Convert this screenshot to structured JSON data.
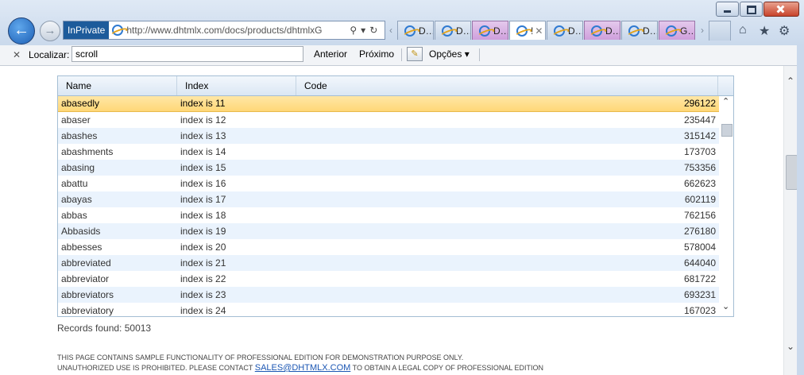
{
  "browser": {
    "inprivate_label": "InPrivate",
    "url": "http://www.dhtmlx.com/docs/products/dhtmlxG",
    "tabs": [
      {
        "label": "D…",
        "style": "normal"
      },
      {
        "label": "D…",
        "style": "normal"
      },
      {
        "label": "D…",
        "style": "purple"
      },
      {
        "label": "!",
        "style": "active"
      },
      {
        "label": "D…",
        "style": "normal"
      },
      {
        "label": "D…",
        "style": "purple"
      },
      {
        "label": "D…",
        "style": "normal"
      },
      {
        "label": "G…",
        "style": "purple"
      }
    ],
    "tab_close_glyph": "✕"
  },
  "findbar": {
    "label": "Localizar:",
    "query": "scroll",
    "prev_label": "Anterior",
    "next_label": "Próximo",
    "options_label": "Opções"
  },
  "grid": {
    "columns": [
      "Name",
      "Index",
      "Code"
    ],
    "rows": [
      {
        "name": "abasedly",
        "index": "index is 11",
        "code": "296122",
        "selected": true
      },
      {
        "name": "abaser",
        "index": "index is 12",
        "code": "235447"
      },
      {
        "name": "abashes",
        "index": "index is 13",
        "code": "315142"
      },
      {
        "name": "abashments",
        "index": "index is 14",
        "code": "173703"
      },
      {
        "name": "abasing",
        "index": "index is 15",
        "code": "753356"
      },
      {
        "name": "abattu",
        "index": "index is 16",
        "code": "662623"
      },
      {
        "name": "abayas",
        "index": "index is 17",
        "code": "602119"
      },
      {
        "name": "abbas",
        "index": "index is 18",
        "code": "762156"
      },
      {
        "name": "Abbasids",
        "index": "index is 19",
        "code": "276180"
      },
      {
        "name": "abbesses",
        "index": "index is 20",
        "code": "578004"
      },
      {
        "name": "abbreviated",
        "index": "index is 21",
        "code": "644040"
      },
      {
        "name": "abbreviator",
        "index": "index is 22",
        "code": "681722"
      },
      {
        "name": "abbreviators",
        "index": "index is 23",
        "code": "693231"
      },
      {
        "name": "abbreviatory",
        "index": "index is 24",
        "code": "167023"
      }
    ]
  },
  "records_text": "Records found: 50013",
  "notice": {
    "line1": "THIS PAGE CONTAINS SAMPLE FUNCTIONALITY OF PROFESSIONAL EDITION FOR DEMONSTRATION PURPOSE ONLY.",
    "line2_before": "UNAUTHORIZED USE IS PROHIBITED. PLEASE CONTACT",
    "email": "SALES@DHTMLX.COM",
    "line2_after": "TO OBTAIN A LEGAL COPY OF PROFESSIONAL EDITION"
  }
}
